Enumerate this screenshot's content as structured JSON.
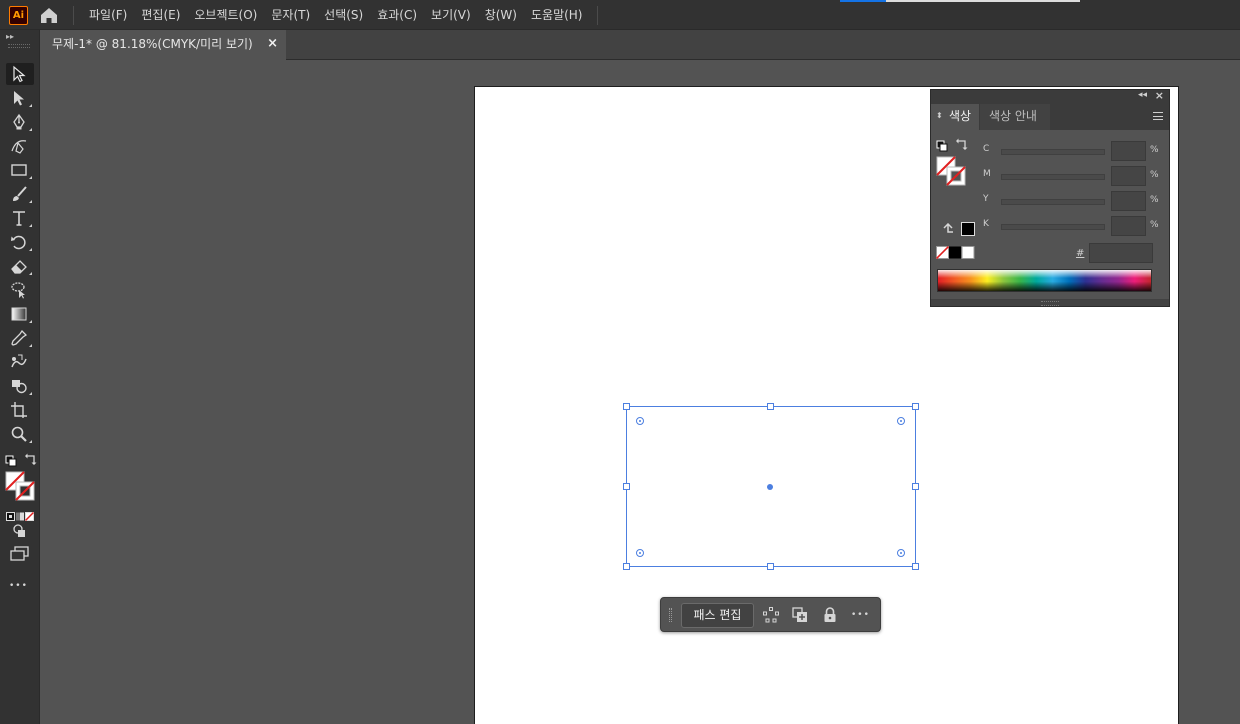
{
  "app": {
    "logo_text": "Ai"
  },
  "menu": {
    "items": [
      "파일(F)",
      "편집(E)",
      "오브젝트(O)",
      "문자(T)",
      "선택(S)",
      "효과(C)",
      "보기(V)",
      "창(W)",
      "도움말(H)"
    ]
  },
  "document": {
    "tab_title": "무제-1* @ 81.18%(CMYK/미리 보기)",
    "close_glyph": "×"
  },
  "tools": [
    "selection-tool",
    "direct-selection-tool",
    "pen-tool",
    "curvature-tool",
    "rectangle-tool",
    "paintbrush-tool",
    "type-tool",
    "rotate-tool",
    "eraser-tool",
    "lasso-tool",
    "gradient-tool",
    "eyedropper-tool",
    "blend-tool",
    "shape-builder-tool",
    "artboard-tool",
    "zoom-tool"
  ],
  "toolbar": {
    "more_glyph": "•••"
  },
  "color_panel": {
    "tabs": [
      "색상",
      "색상 안내"
    ],
    "channels": [
      {
        "label": "C",
        "unit": "%"
      },
      {
        "label": "M",
        "unit": "%"
      },
      {
        "label": "Y",
        "unit": "%"
      },
      {
        "label": "K",
        "unit": "%"
      }
    ],
    "hex_label": "#",
    "collapse_glyph": "◂◂",
    "close_glyph": "×",
    "updown_glyph": "⬍"
  },
  "context_taskbar": {
    "edit_path_label": "패스 편집",
    "more_glyph": "•••"
  },
  "colors": {
    "accent": "#4c7fe0",
    "bar_bg": "#323232",
    "canvas_bg": "#535353",
    "none_red": "#e02020"
  }
}
